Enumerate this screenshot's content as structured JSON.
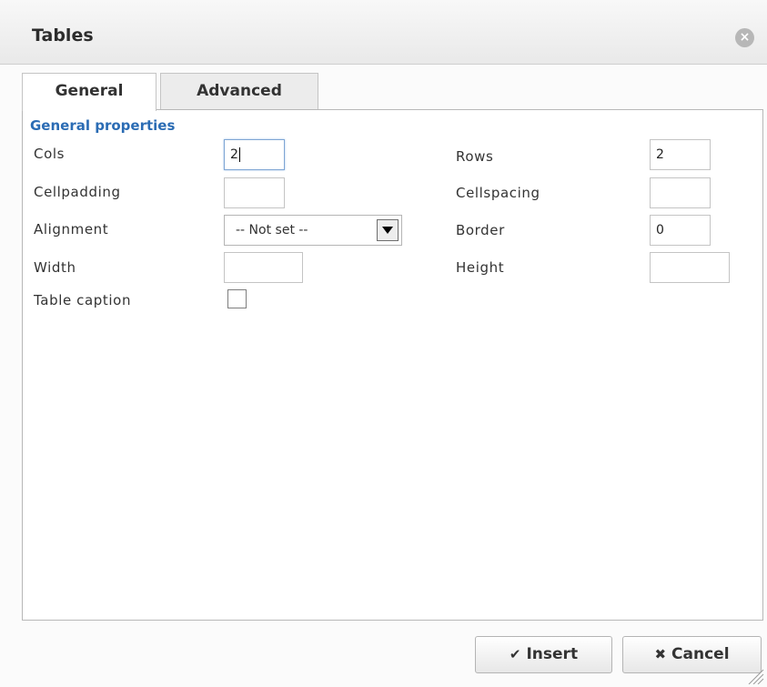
{
  "dialog": {
    "title": "Tables",
    "close_icon": "×"
  },
  "tabs": [
    {
      "label": "General",
      "active": true
    },
    {
      "label": "Advanced",
      "active": false
    }
  ],
  "general": {
    "section_title": "General properties",
    "cols": {
      "label": "Cols",
      "value": "2"
    },
    "rows": {
      "label": "Rows",
      "value": "2"
    },
    "cellpadding": {
      "label": "Cellpadding",
      "value": ""
    },
    "cellspacing": {
      "label": "Cellspacing",
      "value": ""
    },
    "alignment": {
      "label": "Alignment",
      "selected": "-- Not set --"
    },
    "border": {
      "label": "Border",
      "value": "0"
    },
    "width": {
      "label": "Width",
      "value": ""
    },
    "height": {
      "label": "Height",
      "value": ""
    },
    "table_caption": {
      "label": "Table caption",
      "checked": false
    }
  },
  "buttons": {
    "insert_icon": "✔",
    "insert_label": "Insert",
    "cancel_icon": "✖",
    "cancel_label": "Cancel"
  }
}
